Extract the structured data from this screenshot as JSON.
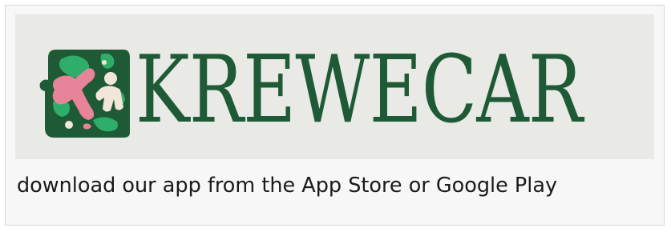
{
  "logo": {
    "wordmark": "KREWECAR",
    "icon": "krewecar-logo-icon",
    "colors": {
      "primary_green": "#1f5a36",
      "bright_green": "#2fae6b",
      "pink": "#e8849a",
      "cream": "#f1e6d8"
    }
  },
  "caption": {
    "text": "download our app from the App Store or Google Play"
  }
}
